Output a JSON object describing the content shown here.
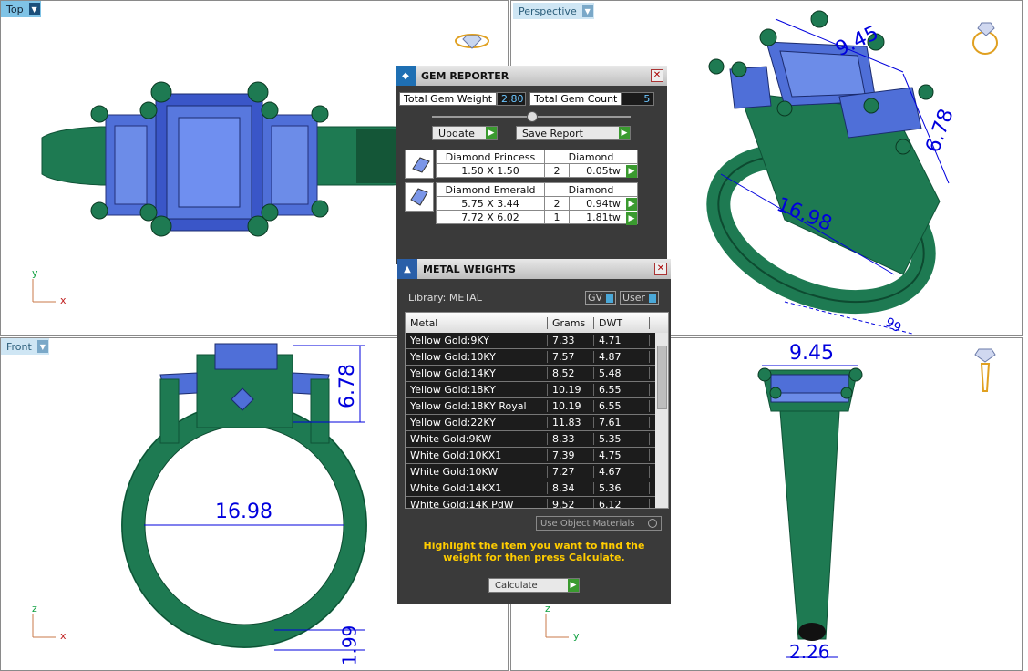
{
  "viewports": {
    "top": {
      "label": "Top",
      "axes": {
        "y": "y",
        "x": "x"
      }
    },
    "perspective": {
      "label": "Perspective",
      "dims": [
        "9.45",
        "6.78",
        "16.98",
        "99"
      ]
    },
    "front": {
      "label": "Front",
      "axes": {
        "z": "z",
        "x": "x"
      },
      "dims": [
        "6.78",
        "16.98",
        "1.99"
      ]
    },
    "right": {
      "axes": {
        "z": "z",
        "y": "y"
      },
      "dims": [
        "9.45",
        "2.26"
      ]
    }
  },
  "gem_reporter": {
    "title": "GEM REPORTER",
    "close": "✕",
    "total_weight_label": "Total Gem Weight",
    "total_weight_value": "2.80",
    "total_count_label": "Total Gem Count",
    "total_count_value": "5",
    "update_label": "Update",
    "save_label": "Save Report",
    "groups": [
      {
        "name": "Diamond Princess",
        "material": "Diamond",
        "rows": [
          {
            "size": "1.50 X 1.50",
            "count": "2",
            "tw": "0.05tw"
          }
        ]
      },
      {
        "name": "Diamond Emerald",
        "material": "Diamond",
        "rows": [
          {
            "size": "5.75 X 3.44",
            "count": "2",
            "tw": "0.94tw"
          },
          {
            "size": "7.72 X 6.02",
            "count": "1",
            "tw": "1.81tw"
          }
        ]
      }
    ]
  },
  "metal_weights": {
    "title": "METAL WEIGHTS",
    "close": "✕",
    "library": "Library: METAL",
    "gv_label": "GV",
    "user_label": "User",
    "columns": [
      "Metal",
      "Grams",
      "DWT"
    ],
    "rows": [
      [
        "Yellow Gold:9KY",
        "7.33",
        "4.71"
      ],
      [
        "Yellow Gold:10KY",
        "7.57",
        "4.87"
      ],
      [
        "Yellow Gold:14KY",
        "8.52",
        "5.48"
      ],
      [
        "Yellow Gold:18KY",
        "10.19",
        "6.55"
      ],
      [
        "Yellow Gold:18KY Royal",
        "10.19",
        "6.55"
      ],
      [
        "Yellow Gold:22KY",
        "11.83",
        "7.61"
      ],
      [
        "White Gold:9KW",
        "8.33",
        "5.35"
      ],
      [
        "White Gold:10KX1",
        "7.39",
        "4.75"
      ],
      [
        "White Gold:10KW",
        "7.27",
        "4.67"
      ],
      [
        "White Gold:14KX1",
        "8.34",
        "5.36"
      ],
      [
        "White Gold:14K PdW",
        "9.52",
        "6.12"
      ]
    ],
    "use_object_materials": "Use Object Materials",
    "hint": "Highlight the item you want to find the weight for then press Calculate.",
    "calculate_label": "Calculate"
  },
  "colors": {
    "metal": "#1e7a52",
    "gem": "#4f6fd8",
    "dimension": "#0000dd",
    "hint": "#ffcc00"
  }
}
